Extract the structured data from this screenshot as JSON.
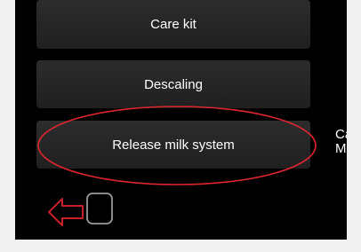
{
  "menu": {
    "care_kit_label": "Care kit",
    "descaling_label": "Descaling",
    "release_milk_label": "Release milk system"
  },
  "side_text": {
    "line1": "Ca",
    "line2": "Mo"
  },
  "icons": {
    "back": "exit-arrow-icon"
  },
  "colors": {
    "screen_bg": "#000000",
    "button_bg": "#262626",
    "text": "#ffffff",
    "annotation": "#e0262f",
    "back_arrow": "#c8202a",
    "back_frame": "#9a9a9a"
  }
}
